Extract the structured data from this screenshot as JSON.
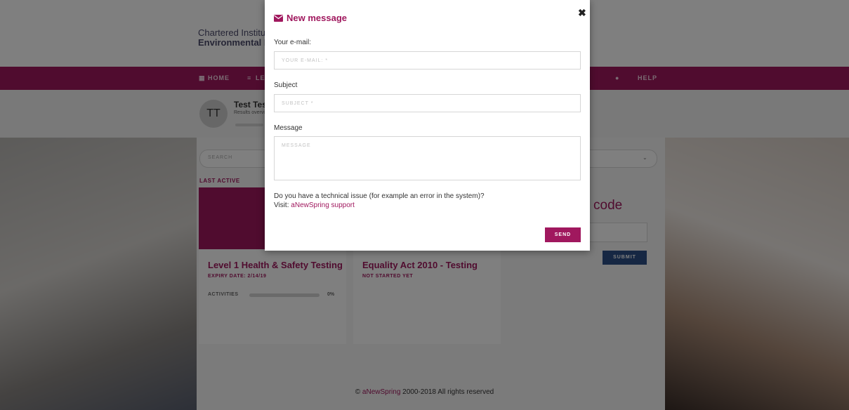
{
  "app": {
    "brand_line1": "Chartered Institute of",
    "brand_line2": "Environmental Health"
  },
  "nav": {
    "home": "HOME",
    "learning": "LEARNING",
    "help": "HELP"
  },
  "user": {
    "initials": "TT",
    "name": "Test Test",
    "subtitle": "Results overview"
  },
  "search": {
    "placeholder": "SEARCH"
  },
  "last_active_label": "LAST ACTIVE",
  "courses": [
    {
      "title": "Level 1 Health & Safety Testing",
      "status": "EXPIRY DATE: 2/14/19",
      "activities_label": "ACTIVITIES",
      "progress": "0%",
      "progress_fraction": 0
    },
    {
      "title": "Equality Act 2010 - Testing",
      "status": "NOT STARTED YET"
    }
  ],
  "code_panel": {
    "heading": "code",
    "submit_label": "SUBMIT"
  },
  "footer": {
    "prefix": "© ",
    "brand": "aNewSpring",
    "suffix": " 2000-2018 All rights reserved"
  },
  "modal": {
    "title": "New message",
    "close_glyph": "✖",
    "email_label": "Your e-mail:",
    "email_placeholder": "YOUR E-MAIL: *",
    "subject_label": "Subject",
    "subject_placeholder": "SUBJECT *",
    "message_label": "Message",
    "message_placeholder": "MESSAGE",
    "issue_text": "Do you have a technical issue (for example an error in the system)?",
    "visit_prefix": "Visit: ",
    "support_link": "aNewSpring support",
    "send_label": "SEND"
  },
  "colors": {
    "accent": "#a0185e",
    "submit_blue": "#2c4f87",
    "overlay": "rgba(0,0,0,0.5)"
  },
  "icons": {
    "modal_title": "envelope-icon",
    "close": "close-icon",
    "nav_home": "grid-icon",
    "nav_learning": "list-icon",
    "nav_notifications": "bell-icon",
    "search_dropdown": "chevron-down-icon"
  }
}
